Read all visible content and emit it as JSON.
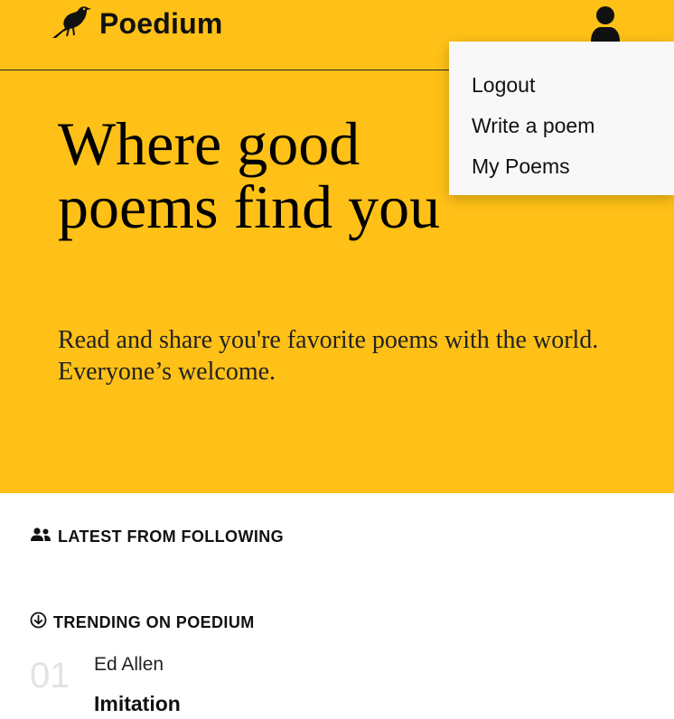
{
  "brand": {
    "name": "Poedium",
    "logo_icon": "crow-icon"
  },
  "header": {
    "user_icon": "user-icon"
  },
  "user_menu": {
    "items": [
      {
        "label": "Logout"
      },
      {
        "label": "Write a poem"
      },
      {
        "label": "My Poems"
      }
    ]
  },
  "hero": {
    "title_line1": "Where good",
    "title_line2": "poems find you",
    "subtitle": "Read and share you're favorite poems with the world. Everyone’s welcome.",
    "background_color": "#FFC117"
  },
  "sections": {
    "following": {
      "label": "LATEST FROM FOLLOWING",
      "icon": "users-icon"
    },
    "trending": {
      "label": "TRENDING ON POEDIUM",
      "icon": "arrow-circle-down-icon"
    }
  },
  "trending_items": [
    {
      "rank": "01",
      "author": "Ed Allen",
      "title": "Imitation"
    }
  ]
}
